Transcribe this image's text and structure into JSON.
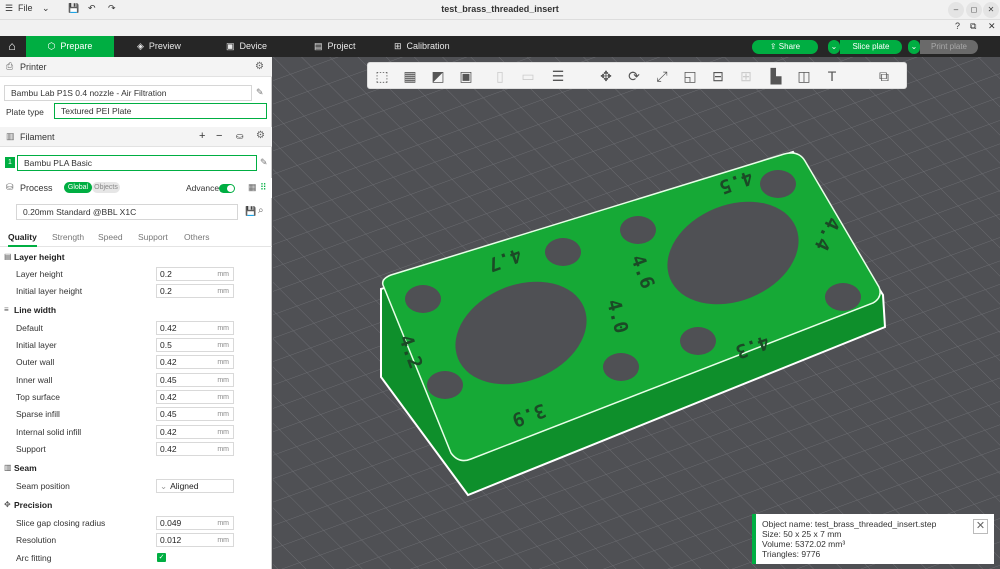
{
  "window": {
    "title": "test_brass_threaded_insert",
    "file_menu": "File"
  },
  "tabs": [
    {
      "label": "Prepare",
      "icon": "cube-icon"
    },
    {
      "label": "Preview",
      "icon": "layers-icon"
    },
    {
      "label": "Device",
      "icon": "device-icon"
    },
    {
      "label": "Project",
      "icon": "project-icon"
    },
    {
      "label": "Calibration",
      "icon": "calibration-icon"
    }
  ],
  "actions": {
    "share": "Share",
    "slice": "Slice plate",
    "print": "Print plate"
  },
  "printer": {
    "section": "Printer",
    "name": "Bambu Lab P1S 0.4 nozzle - Air Filtration",
    "plate_type_label": "Plate type",
    "plate_type": "Textured PEI Plate"
  },
  "filament": {
    "section": "Filament",
    "slot": "1",
    "name": "Bambu PLA Basic",
    "slot_color": "#00ae42"
  },
  "process": {
    "section": "Process",
    "global": "Global",
    "objects": "Objects",
    "advance": "Advance",
    "advance_on": true,
    "preset": "0.20mm Standard @BBL X1C"
  },
  "subtabs": [
    "Quality",
    "Strength",
    "Speed",
    "Support",
    "Others"
  ],
  "settings": {
    "layer_height": {
      "title": "Layer height",
      "rows": [
        {
          "label": "Layer height",
          "value": "0.2",
          "unit": "mm"
        },
        {
          "label": "Initial layer height",
          "value": "0.2",
          "unit": "mm"
        }
      ]
    },
    "line_width": {
      "title": "Line width",
      "rows": [
        {
          "label": "Default",
          "value": "0.42",
          "unit": "mm"
        },
        {
          "label": "Initial layer",
          "value": "0.5",
          "unit": "mm"
        },
        {
          "label": "Outer wall",
          "value": "0.42",
          "unit": "mm"
        },
        {
          "label": "Inner wall",
          "value": "0.45",
          "unit": "mm"
        },
        {
          "label": "Top surface",
          "value": "0.42",
          "unit": "mm"
        },
        {
          "label": "Sparse infill",
          "value": "0.45",
          "unit": "mm"
        },
        {
          "label": "Internal solid infill",
          "value": "0.42",
          "unit": "mm"
        },
        {
          "label": "Support",
          "value": "0.42",
          "unit": "mm"
        }
      ]
    },
    "seam": {
      "title": "Seam",
      "position_label": "Seam position",
      "position_value": "Aligned"
    },
    "precision": {
      "title": "Precision",
      "rows": [
        {
          "label": "Slice gap closing radius",
          "value": "0.049",
          "unit": "mm"
        },
        {
          "label": "Resolution",
          "value": "0.012",
          "unit": "mm"
        }
      ],
      "arc_label": "Arc fitting",
      "arc_checked": true
    }
  },
  "object_info": {
    "name": "Object name: test_brass_threaded_insert.step",
    "size": "Size: 50 x 25 x 7 mm",
    "volume": "Volume: 5372.02 mm³",
    "triangles": "Triangles: 9776"
  },
  "model_labels": [
    "4.5",
    "4.4",
    "4.7",
    "4.6",
    "4.0",
    "4.2",
    "4.3",
    "3.9"
  ],
  "colors": {
    "accent": "#00ae42",
    "model": "#16a936",
    "bed": "#4f5054",
    "tabbar": "#262626"
  }
}
